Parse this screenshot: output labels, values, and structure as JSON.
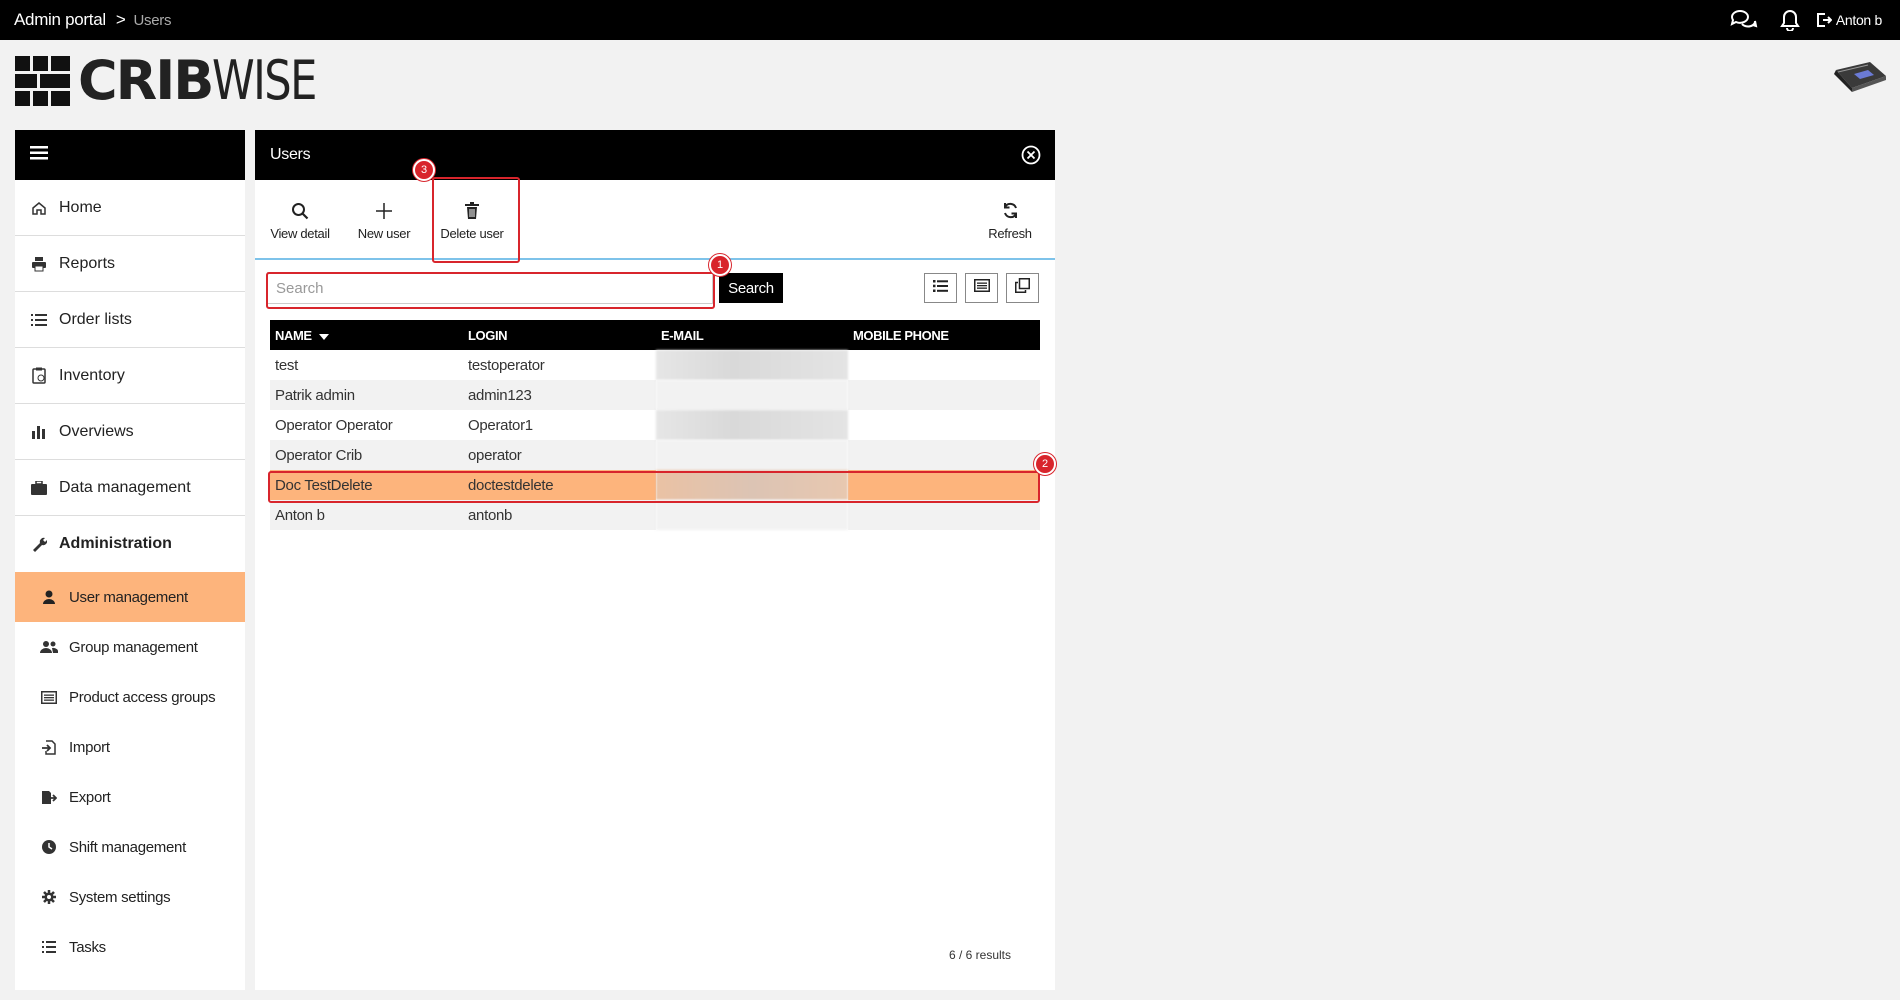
{
  "topbar": {
    "breadcrumb_root": "Admin portal",
    "breadcrumb_sep": ">",
    "breadcrumb_current": "Users",
    "user_name": "Anton b",
    "icons": [
      "chat-icon",
      "bell-icon",
      "logout-icon"
    ]
  },
  "logo": {
    "part1": "CRIB",
    "part2": "WISE"
  },
  "sidebar": {
    "items": [
      {
        "label": "Home",
        "icon": "home-icon"
      },
      {
        "label": "Reports",
        "icon": "printer-icon"
      },
      {
        "label": "Order lists",
        "icon": "list-icon"
      },
      {
        "label": "Inventory",
        "icon": "clipboard-icon"
      },
      {
        "label": "Overviews",
        "icon": "bar-chart-icon"
      },
      {
        "label": "Data management",
        "icon": "briefcase-icon"
      },
      {
        "label": "Administration",
        "icon": "wrench-icon"
      }
    ],
    "sub_items": [
      {
        "label": "User management",
        "icon": "user-icon"
      },
      {
        "label": "Group management",
        "icon": "users-icon"
      },
      {
        "label": "Product access groups",
        "icon": "list-alt-icon"
      },
      {
        "label": "Import",
        "icon": "import-icon"
      },
      {
        "label": "Export",
        "icon": "export-icon"
      },
      {
        "label": "Shift management",
        "icon": "clock-icon"
      },
      {
        "label": "System settings",
        "icon": "gear-icon"
      },
      {
        "label": "Tasks",
        "icon": "tasks-icon"
      }
    ]
  },
  "panel": {
    "title": "Users",
    "toolbar": {
      "view_detail": "View detail",
      "new_user": "New user",
      "delete_user": "Delete user",
      "refresh": "Refresh"
    },
    "search": {
      "placeholder": "Search",
      "button": "Search"
    },
    "table": {
      "headers": [
        "NAME",
        "LOGIN",
        "E-MAIL",
        "MOBILE PHONE"
      ],
      "rows": [
        {
          "name": "test",
          "login": "testoperator"
        },
        {
          "name": "Patrik admin",
          "login": "admin123"
        },
        {
          "name": "Operator Operator",
          "login": "Operator1"
        },
        {
          "name": "Operator Crib",
          "login": "operator"
        },
        {
          "name": "Doc TestDelete",
          "login": "doctestdelete"
        },
        {
          "name": "Anton b",
          "login": "antonb"
        }
      ],
      "selected_row_index": 4
    },
    "results": "6 / 6 results"
  },
  "annotations": {
    "badge1": "1",
    "badge2": "2",
    "badge3": "3"
  },
  "colors": {
    "accent": "#fdb47c",
    "highlight": "#d8252c",
    "divider": "#7ec3ea"
  }
}
